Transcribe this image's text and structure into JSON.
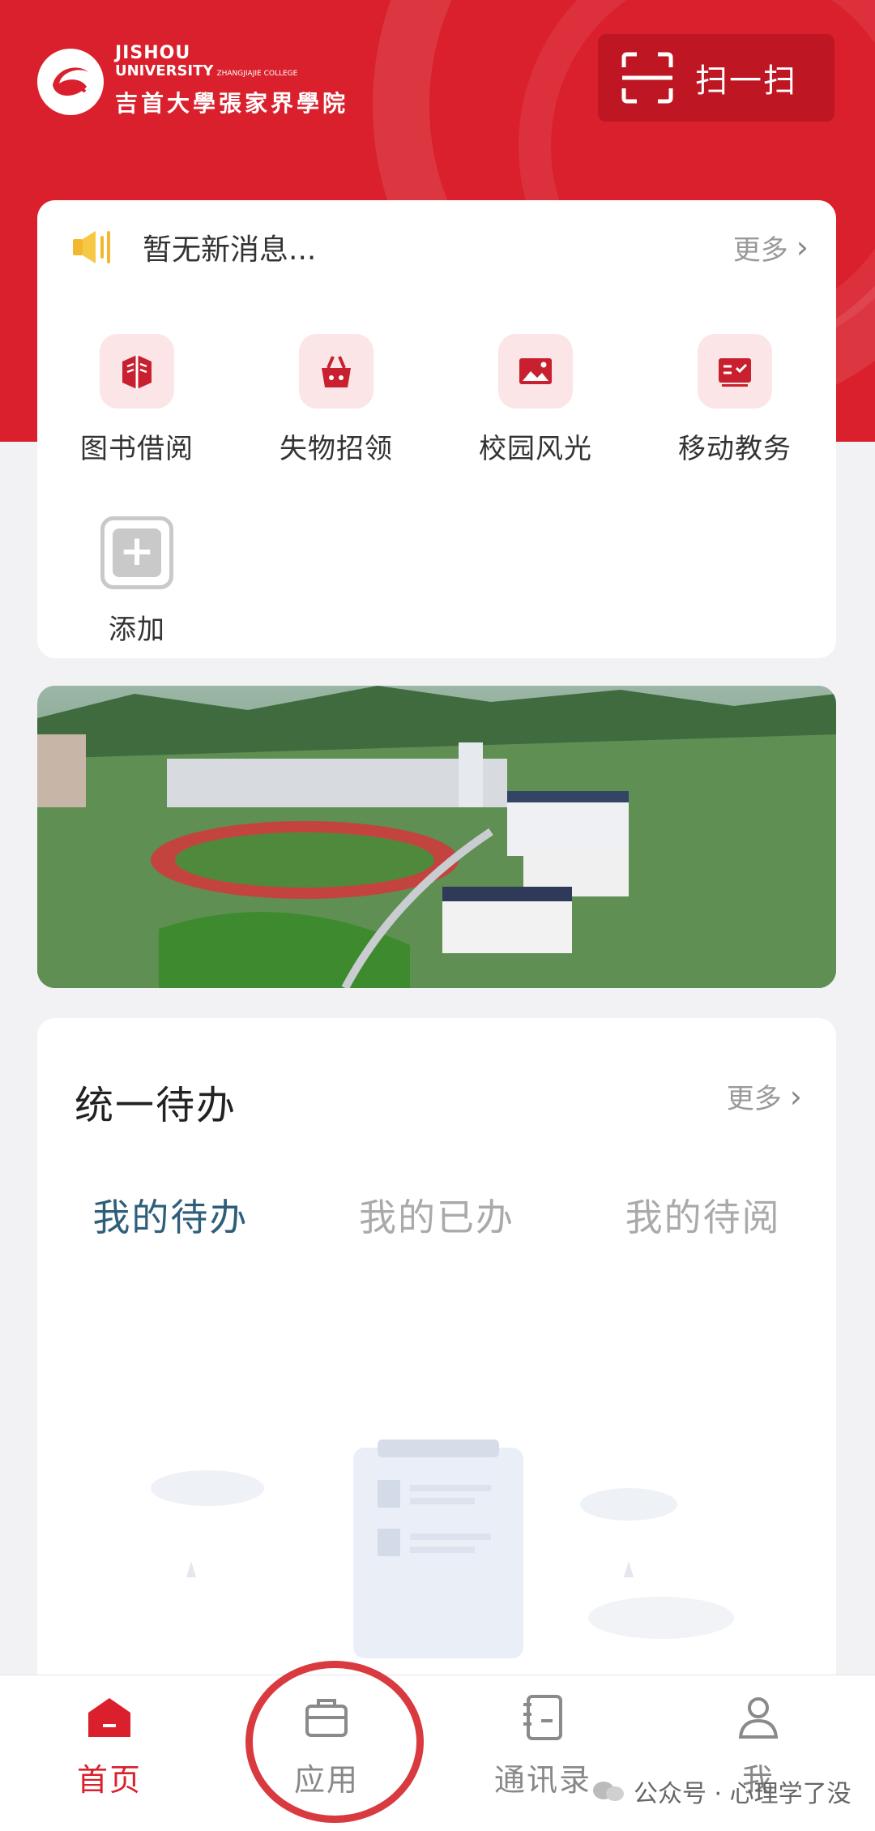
{
  "colors": {
    "brand": "#d9202c",
    "tab_active": "#2e5e7a",
    "muted": "#999999"
  },
  "header": {
    "logo": {
      "icon": "university-logo-icon",
      "en_line1": "JISHOU",
      "en_line2": "UNIVERSITY",
      "en_sub": "ZHANGJIAJIE COLLEGE",
      "cn_name": "吉首大學張家界學院"
    },
    "scan": {
      "icon": "scan-icon",
      "label": "扫一扫"
    }
  },
  "notice": {
    "icon": "speaker-icon",
    "text": "暂无新消息...",
    "more_label": "更多"
  },
  "quick_apps": [
    {
      "icon": "library-books-icon",
      "label": "图书借阅"
    },
    {
      "icon": "lost-found-basket-icon",
      "label": "失物招领"
    },
    {
      "icon": "campus-scenery-image-icon",
      "label": "校园风光"
    },
    {
      "icon": "mobile-academic-icon",
      "label": "移动教务"
    },
    {
      "icon": "add-icon",
      "label": "添加"
    }
  ],
  "banner": {
    "icon": "campus-aerial-photo"
  },
  "todo": {
    "title": "统一待办",
    "more_label": "更多",
    "tabs": [
      {
        "label": "我的待办",
        "active": true
      },
      {
        "label": "我的已办",
        "active": false
      },
      {
        "label": "我的待阅",
        "active": false
      }
    ]
  },
  "bottom_nav": [
    {
      "icon": "home-icon",
      "label": "首页",
      "active": true
    },
    {
      "icon": "briefcase-icon",
      "label": "应用",
      "active": false
    },
    {
      "icon": "contacts-book-icon",
      "label": "通讯录",
      "active": false
    },
    {
      "icon": "user-icon",
      "label": "我",
      "active": false
    }
  ],
  "watermark": {
    "text": "公众号 · 心理学了没"
  }
}
